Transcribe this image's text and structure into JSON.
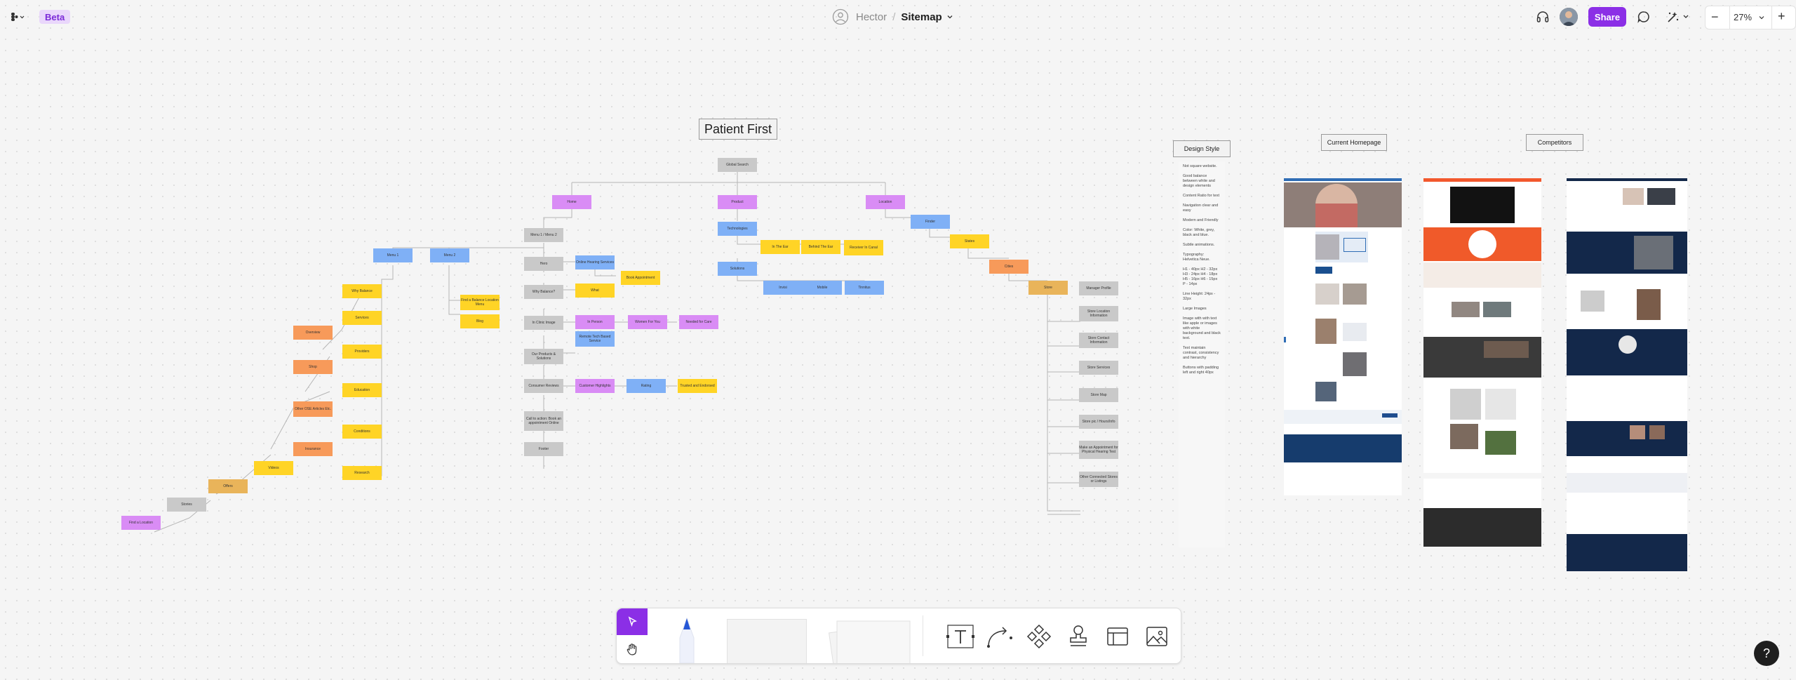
{
  "topbar": {
    "beta_label": "Beta",
    "owner": "Hector",
    "separator": "/",
    "file_name": "Sitemap",
    "share_label": "Share",
    "zoom": "27%",
    "zoom_out": "−",
    "zoom_in": "+"
  },
  "sitemap": {
    "title": "Patient First",
    "nodes": {
      "root": "Global Search",
      "n_home": "Home",
      "n_product": "Product",
      "n_location": "Location",
      "n_menu": "Menu 1 / Menu 2",
      "n_menu1": "Menu 1",
      "n_menu2": "Menu 2",
      "n_why_balance": "Why Balance",
      "n_services": "Services",
      "n_overview": "Overview",
      "n_providers": "Providers",
      "n_shop": "Shop",
      "n_education": "Education",
      "n_ofs": "Other OSE Articles Etc.",
      "n_conditions": "Conditions",
      "n_insurance": "Insurance",
      "n_research": "Research",
      "n_videos": "Videos",
      "n_offers": "Offers",
      "n_stories": "Stories",
      "n_find_location": "Find a Location",
      "n_find_loc_menu": "Find a Balance Location Menu",
      "n_blog": "Blog",
      "n_hero": "Hero",
      "n_online_services": "Online Hearing Services",
      "n_book_appt": "Book Appointment",
      "n_what": "What",
      "n_why_balance2": "Why Balance?",
      "n_in_clinic": "In Clinic Image",
      "n_in_person": "In Person",
      "n_remote": "Remote Tech Based Service",
      "n_women_for_you": "Women For You",
      "n_needed_care": "Needed for Care",
      "n_products": "Our Products & Solutions",
      "n_consumer_reviews": "Consumer Reviews",
      "n_customer_highlights": "Customer Highlights",
      "n_rating": "Rating",
      "n_trusted": "Trusted and Endorsed",
      "n_cta_online": "Call to action: Book an appointment Online",
      "n_footer": "Footer",
      "n_technologies": "Technologies",
      "n_in_the_ear": "In The Ear",
      "n_behind_ear": "Behind The Ear",
      "n_receiver_canal": "Receiver In Canal",
      "n_solutions": "Solutions",
      "n_sol_a": "Invisi",
      "n_sol_b": "Mobile",
      "n_sol_c": "Tinnitus",
      "n_finder": "Finder",
      "n_states": "States",
      "n_cities": "Cities",
      "n_store": "Store",
      "n_mgr_profile": "Manager Profile",
      "n_store_info": "Store Location Information",
      "n_store_contact": "Store Contact Information",
      "n_store_services": "Store Services",
      "n_store_map": "Store Map",
      "n_store_hours": "Store pic / Hours/Info",
      "n_make_appt": "Make an Appointment for Physical Hearing Test",
      "n_other_stores": "Other Connected Stores or Listings"
    }
  },
  "design_style": {
    "title": "Design Style",
    "notes": [
      "Not square website.",
      "Good balance between white and design elements",
      "Content Ratio for text",
      "Navigation clear and easy",
      "Modern and Friendly",
      "Color: White, grey, black and blue.",
      "Subtle animations.",
      "Typography: Helvetica Neue.",
      "H1 - 40px H2 - 32px H3 - 24px H4 - 18px H5 - 16px H6 - 15px P - 14px",
      "Line Height: 24px - 32px",
      "Large Images",
      "Image with with text like apple or images with white background and black text.",
      "Text maintain contrast, consistency and hierarchy",
      "Buttons with padding left and right 40px"
    ]
  },
  "current_homepage": {
    "label": "Current Homepage"
  },
  "competitors": {
    "label": "Competitors"
  },
  "toolbar": {
    "tools": [
      "select",
      "hand",
      "pen",
      "text",
      "connector",
      "component",
      "stamp",
      "section",
      "image"
    ]
  },
  "help_label": "?"
}
